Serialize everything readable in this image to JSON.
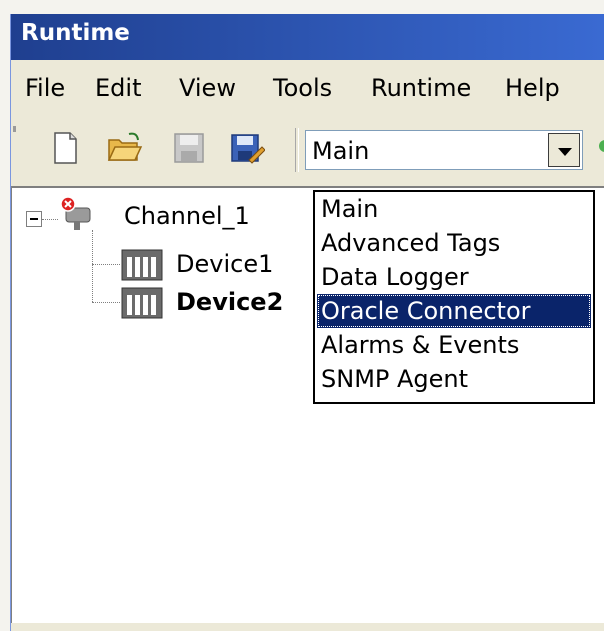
{
  "window": {
    "title": "Runtime"
  },
  "menubar": {
    "items": [
      "File",
      "Edit",
      "View",
      "Tools",
      "Runtime",
      "Help"
    ]
  },
  "toolbar": {
    "buttons": [
      "new-document-icon",
      "open-folder-icon",
      "save-icon",
      "save-as-icon"
    ],
    "combo": {
      "value": "Main"
    }
  },
  "tree": {
    "channel": {
      "label": "Channel_1"
    },
    "devices": [
      {
        "label": "Device1"
      },
      {
        "label": "Device2"
      }
    ]
  },
  "dropdown": {
    "options": [
      "Main",
      "Advanced Tags",
      "Data Logger",
      "Oracle Connector",
      "Alarms & Events",
      "SNMP Agent"
    ],
    "selected": "Oracle Connector"
  },
  "colors": {
    "titlebar": "#1f3f8f",
    "selection": "#0a246a",
    "chrome": "#ece9d8"
  }
}
